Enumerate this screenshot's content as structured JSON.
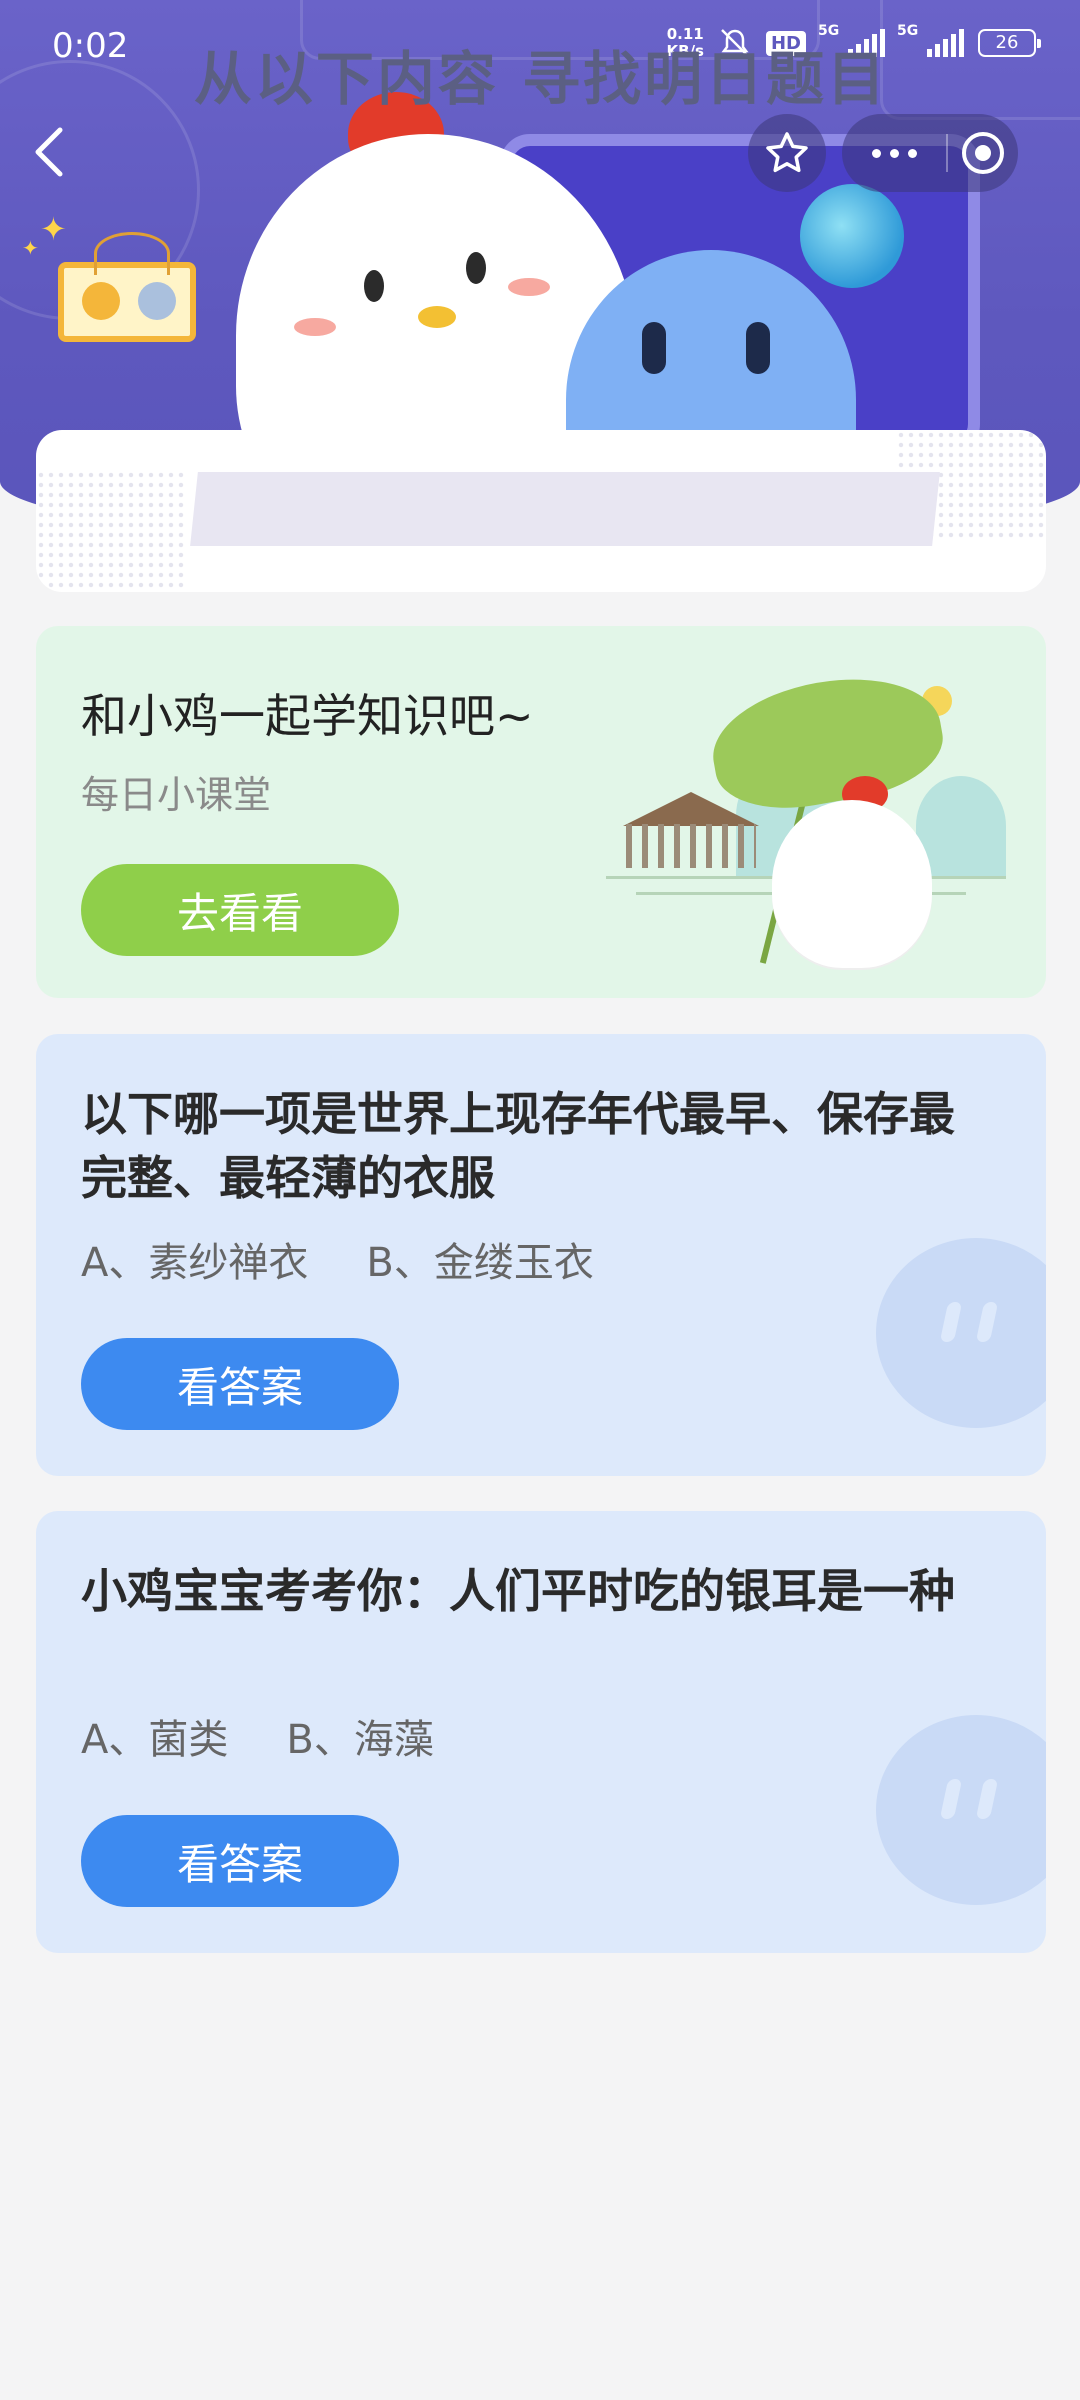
{
  "status_bar": {
    "time": "0:02",
    "net_speed_value": "0.11",
    "net_speed_unit": "KB/s",
    "hd_label": "HD",
    "signal_1_label": "5G",
    "signal_2_label": "5G",
    "battery": "26"
  },
  "nav": {
    "back_icon": "chevron-left-icon",
    "favorite_icon": "star-outline-icon",
    "more_icon": "more-dots-icon",
    "close_icon": "target-circle-icon"
  },
  "banner": {
    "title": "从以下内容 寻找明日题目"
  },
  "lesson_card": {
    "title": "和小鸡一起学知识吧~",
    "subtitle": "每日小课堂",
    "button_label": "去看看"
  },
  "questions": [
    {
      "title": "以下哪一项是世界上现存年代最早、保存最完整、最轻薄的衣服",
      "option_a": "A、素纱禅衣",
      "option_b": "B、金缕玉衣",
      "button_label": "看答案"
    },
    {
      "title": "小鸡宝宝考考你：人们平时吃的银耳是一种",
      "option_a": "A、菌类",
      "option_b": "B、海藻",
      "button_label": "看答案"
    }
  ],
  "colors": {
    "header_purple": "#5e58be",
    "green_card": "#e2f6e8",
    "green_button": "#8fcf4a",
    "blue_card": "#dde9fb",
    "blue_button": "#3d8af0"
  }
}
